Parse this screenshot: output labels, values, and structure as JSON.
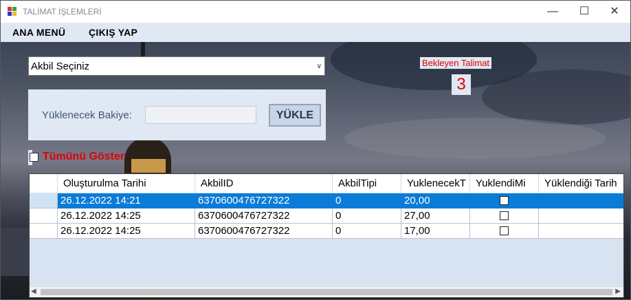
{
  "window": {
    "title": "TALİMAT İŞLEMLERİ",
    "minimize_glyph": "—",
    "maximize_glyph": "☐",
    "close_glyph": "✕"
  },
  "menu": {
    "items": [
      "ANA MENÜ",
      "ÇIKIŞ YAP"
    ]
  },
  "akbil_select": {
    "selected": "Akbil Seçiniz",
    "chevron_icon": "chevron-down-icon"
  },
  "bakiye": {
    "label": "Yüklenecek Bakiye:",
    "value": "",
    "button_label": "YÜKLE"
  },
  "bekleyen": {
    "label": "Bekleyen Talimat",
    "count": "3"
  },
  "tumunu": {
    "label": "Tümünü Göster",
    "checked": false
  },
  "grid": {
    "columns": [
      "Oluşturulma Tarihi",
      "AkbilID",
      "AkbilTipi",
      "YuklenecekT",
      "YuklendiMi",
      "Yüklendiği Tarih"
    ],
    "rows": [
      {
        "tarih": "26.12.2022 14:21",
        "akbil_id": "6370600476727322",
        "tip": "0",
        "tutar": "20,00",
        "yuklendi": false,
        "yuklendigi": "",
        "selected": true
      },
      {
        "tarih": "26.12.2022 14:25",
        "akbil_id": "6370600476727322",
        "tip": "0",
        "tutar": "27,00",
        "yuklendi": false,
        "yuklendigi": "",
        "selected": false
      },
      {
        "tarih": "26.12.2022 14:25",
        "akbil_id": "6370600476727322",
        "tip": "0",
        "tutar": "17,00",
        "yuklendi": false,
        "yuklendigi": "",
        "selected": false
      }
    ]
  },
  "colors": {
    "accent_red": "#e00000",
    "selection_blue": "#0a7bd8",
    "panel_bg": "#dfe8f3"
  }
}
